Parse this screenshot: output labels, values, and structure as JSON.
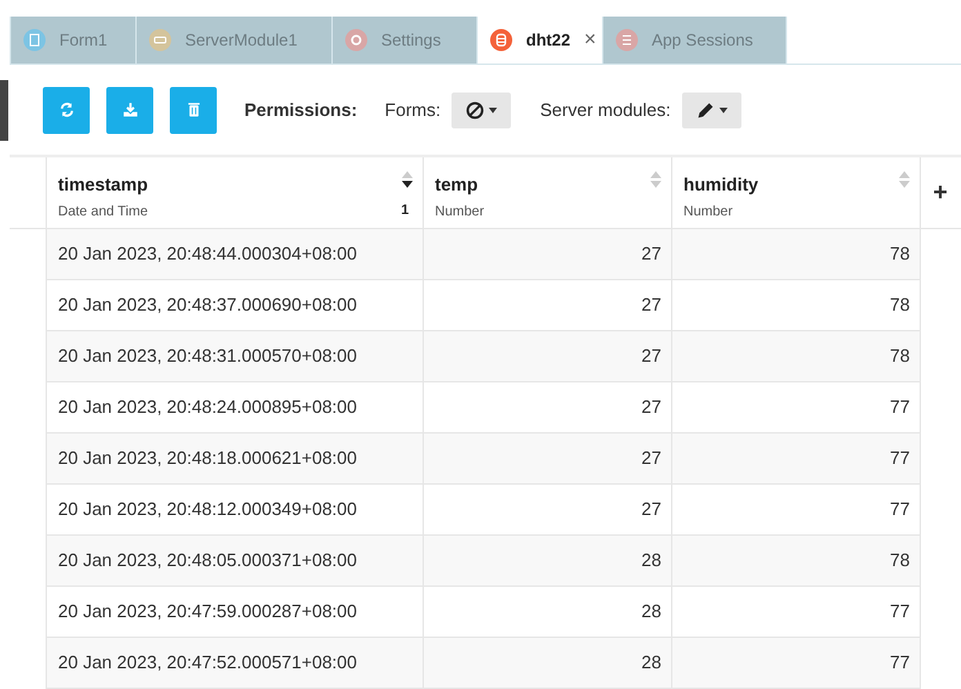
{
  "tabs": [
    {
      "label": "Form1",
      "kind": "form",
      "selected": false
    },
    {
      "label": "ServerModule1",
      "kind": "server",
      "selected": false
    },
    {
      "label": "Settings",
      "kind": "settings",
      "selected": false
    },
    {
      "label": "dht22",
      "kind": "table",
      "selected": true,
      "close": "×"
    },
    {
      "label": "App Sessions",
      "kind": "sessions",
      "selected": false
    }
  ],
  "toolbar": {
    "buttons": [
      {
        "kind": "refresh"
      },
      {
        "kind": "download"
      },
      {
        "kind": "delete"
      }
    ],
    "permissions_label": "Permissions:",
    "forms_label": "Forms:",
    "forms_dropdown": {
      "kind": "none"
    },
    "server_label": "Server modules:",
    "server_dropdown": {
      "kind": "edit"
    }
  },
  "table": {
    "columns": [
      {
        "name": "timestamp",
        "type": "Date and Time",
        "sorted": true,
        "descending": true,
        "sort_order": "1"
      },
      {
        "name": "temp",
        "type": "Number",
        "sorted": false
      },
      {
        "name": "humidity",
        "type": "Number",
        "sorted": false
      }
    ],
    "add_column": "+",
    "rows": [
      [
        "20 Jan 2023, 20:48:44.000304+08:00",
        "27",
        "78"
      ],
      [
        "20 Jan 2023, 20:48:37.000690+08:00",
        "27",
        "78"
      ],
      [
        "20 Jan 2023, 20:48:31.000570+08:00",
        "27",
        "78"
      ],
      [
        "20 Jan 2023, 20:48:24.000895+08:00",
        "27",
        "77"
      ],
      [
        "20 Jan 2023, 20:48:18.000621+08:00",
        "27",
        "77"
      ],
      [
        "20 Jan 2023, 20:48:12.000349+08:00",
        "27",
        "77"
      ],
      [
        "20 Jan 2023, 20:48:05.000371+08:00",
        "28",
        "78"
      ],
      [
        "20 Jan 2023, 20:47:59.000287+08:00",
        "28",
        "77"
      ],
      [
        "20 Jan 2023, 20:47:52.000571+08:00",
        "28",
        "77"
      ]
    ]
  }
}
